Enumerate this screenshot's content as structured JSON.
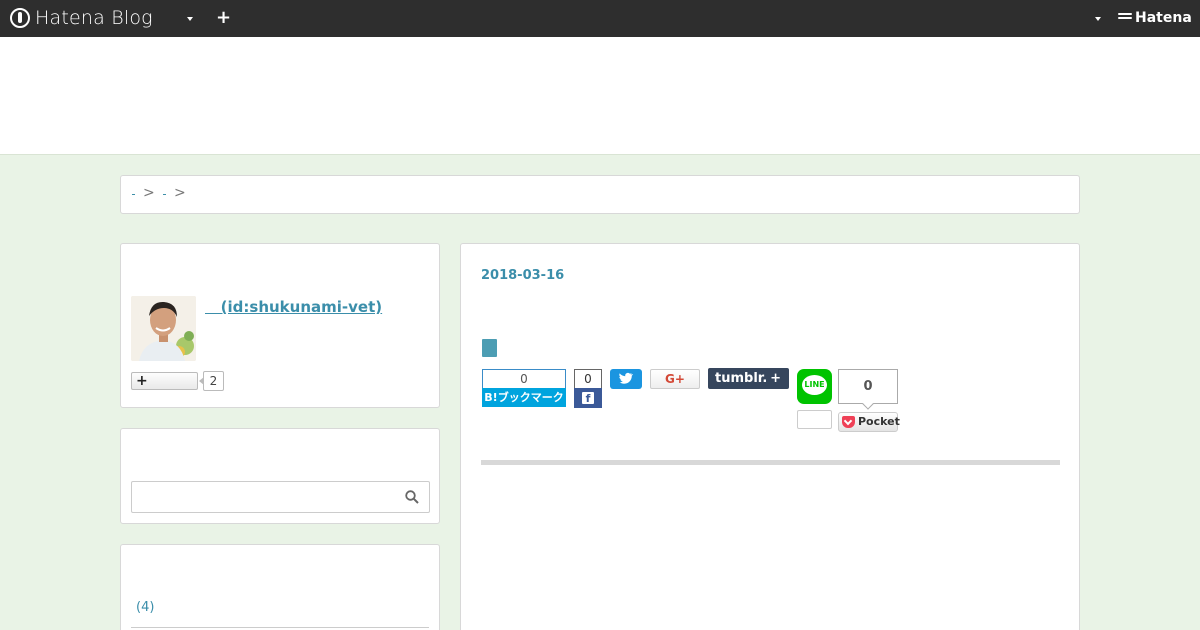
{
  "topbar": {
    "logo_text": "Hatena Blog",
    "plus_label": "+",
    "brand_text": "Hatena"
  },
  "breadcrumb": {
    "separator_1": ">",
    "separator_2": ">"
  },
  "profile": {
    "id_text": "   (id:shukunami-vet)",
    "subscribe_label": "+",
    "subscriber_count": "2"
  },
  "search": {
    "placeholder": "",
    "value": ""
  },
  "categories": {
    "count_text": "(4)"
  },
  "article": {
    "date": "2018-03-16"
  },
  "share": {
    "hatebu_count": "0",
    "hatebu_label": "B!ブックマーク",
    "facebook_count": "0",
    "facebook_label": "f",
    "google_label": "G+",
    "tumblr_label": "tumblr.",
    "tumblr_plus": "+",
    "line_label": "LINE",
    "pocket_count": "0",
    "pocket_label": "Pocket"
  },
  "colors": {
    "topbar_bg": "#2e2e2e",
    "page_bg": "#e9f3e6",
    "link": "#3b8eaa",
    "hatebu": "#00a4de",
    "facebook": "#3b5998",
    "twitter": "#1b95e0",
    "tumblr": "#36465d",
    "line": "#00c300",
    "pocket": "#ef4056"
  }
}
